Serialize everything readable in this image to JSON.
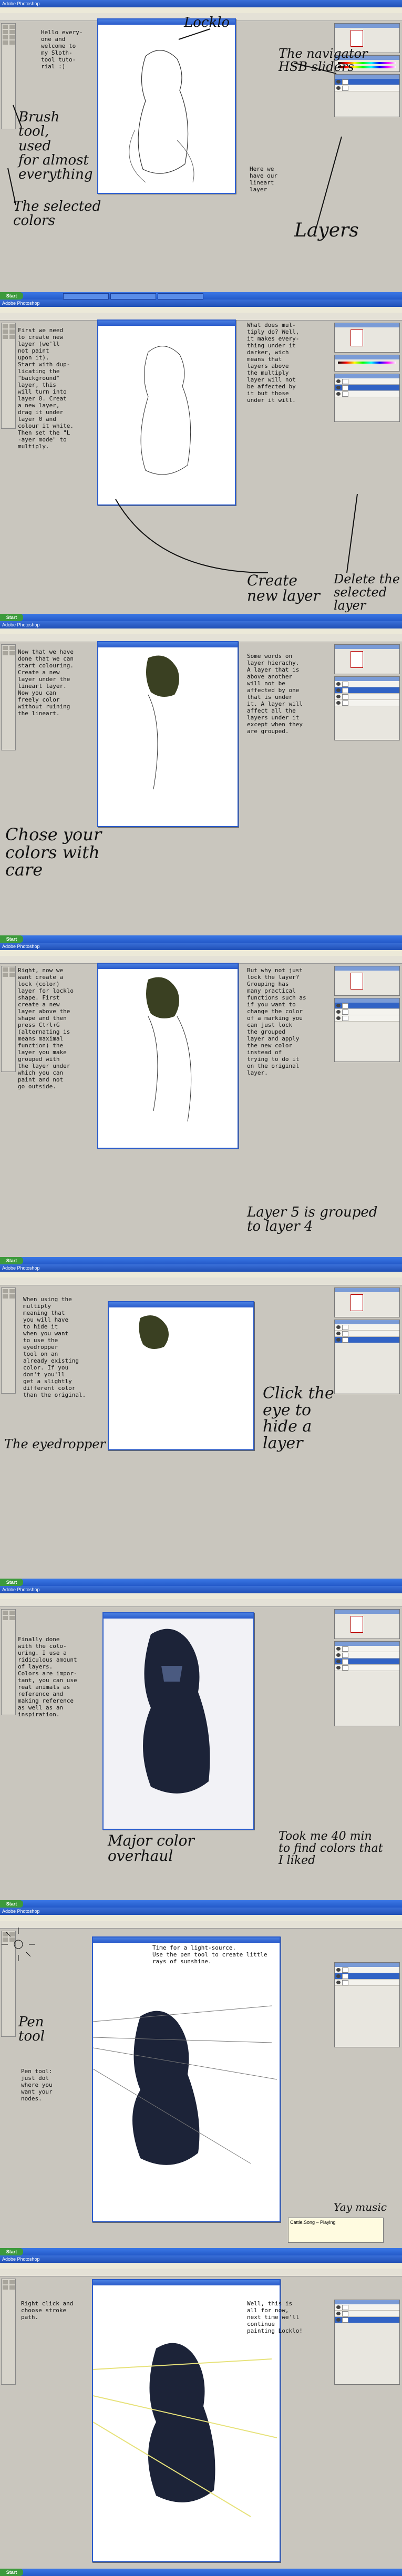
{
  "app": {
    "title": "Adobe Photoshop",
    "start_label": "Start"
  },
  "panels": [
    {
      "doc_title": "Lockl(o)-1 @ 50% (Lineart,RGB)",
      "typed": "Hello every-\none and\nwelcome to\nmy Sloth-\ntool tuto-\nrial :)",
      "typed2": "Here we\nhave our\nlineart\nlayer",
      "notes": {
        "locklo": "Locklo",
        "navigator": "The navigator\nHSB sliders",
        "brush": "Brush\ntool,\nused\nfor almost\neverything",
        "colors": "The selected\ncolors",
        "layers": "Layers"
      }
    },
    {
      "typed": "First we need\nto create new\nlayer (we'll\nnot paint\nupon it).\nStart with dup-\nlicating the\n\"background\"\nlayer, this\nwill turn into\nlayer 0. Creat\na new layer,\ndrag it under\nlayer 0 and\ncolour it white.\nThen set the \"L\n-ayer mode\" to\nmultiply.",
      "typed2": "What does mul-\ntiply do? Well,\nit makes every-\nthing under it\ndarker, wich\nmeans that\nlayers above\nthe multiply\nlayer will not\nbe affected by\nit but those\nunder it will.",
      "notes": {
        "create": "Create\nnew layer",
        "delete": "Delete the\nselected\nlayer"
      }
    },
    {
      "typed": "Now that we have\ndone that we can\nstart colouring.\nCreate a new\nlayer under the\nlineart layer.\nNow you can\nfreely color\nwithout ruining\nthe lineart.",
      "typed2": "Some words on\nlayer hierachy.\nA layer that is\nabove another\nwill not be\naffected by one\nthat is under\nit. A layer will\naffect all the\nlayers under it\nexcept when they\nare grouped.",
      "notes": {
        "choose": "Chose your\ncolors with\ncare"
      }
    },
    {
      "typed": "Right, now we\nwant create a\nlock (color)\nlayer for locklo\nshape. First\ncreate a new\nlayer above the\nshape and then\npress Ctrl+G\n(alternating is\nmeans maximal\nfunction) the\nlayer you make\ngrouped with\nthe layer under\nwhich you can\npaint and not\ngo outside.",
      "typed2": "But why not just\nlock the layer?\nGrouping has\nmany practical\nfunctions such as\nif you want to\nchange the color\nof a marking you\ncan just lock\nthe grouped\nlayer and apply\nthe new color\ninstead of\ntrying to do it\non the original\nlayer.",
      "notes": {
        "grouped": "Layer 5 is grouped\nto layer 4"
      }
    },
    {
      "typed": "When using the\nmultiply\nmeaning that\nyou will have\nto hide it\nwhen you want\nto use the\neyedropper\ntool on an\nalready existing\ncolor. If you\ndon't you'll\nget a slightly\ndifferent color\nthan the original.",
      "notes": {
        "hide": "Click the\neye to\nhide a\nlayer",
        "eyedropper": "The eyedropper"
      }
    },
    {
      "typed": "Finally done\nwith the colo-\nuring. I use a\nridiculous amount\nof layers.\nColors are impor-\ntant, you can use\nreal animals as\nreference and\nmaking reference\nas well as an\ninspiration.",
      "notes": {
        "overhaul": "Major color\noverhaul",
        "took": "Took me 40 min\nto find colors that\nI liked"
      }
    },
    {
      "typed": "Time for a light-source.\nUse the pen tool to create little\nrays of sunshine.",
      "typed2": "Pen tool:\njust dot\nwhere you\nwant your\nnodes.",
      "notes": {
        "pentool": "Pen\ntool",
        "music": "Yay music"
      },
      "popup": "Cattle.Song – Playing"
    },
    {
      "typed": "Right click and\nchoose stroke\npath.",
      "typed2": "Well, this is\nall for now,\nnext time we'll\ncontinue\npainting Locklo!"
    }
  ],
  "colors": {
    "xp_blue": "#2a5bcb",
    "xp_green": "#3c9a3c",
    "ui_gray": "#c9c6be",
    "creature_dark": "#1c2338"
  }
}
